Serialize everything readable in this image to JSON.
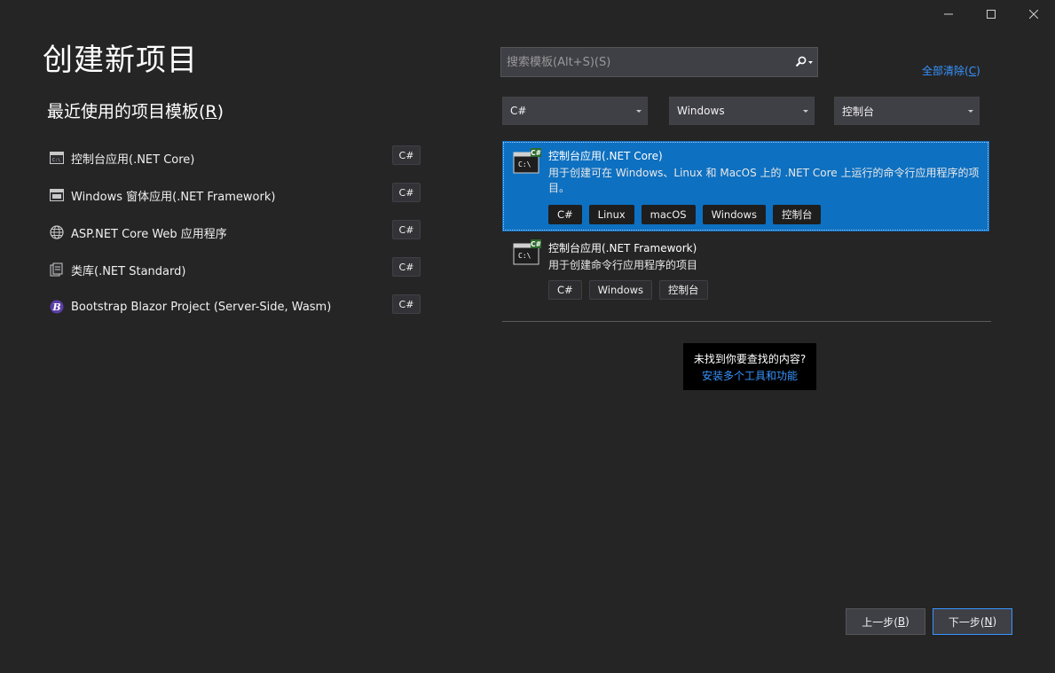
{
  "window": {
    "minimize_icon": "minimize-icon",
    "maximize_icon": "maximize-icon",
    "close_icon": "close-icon"
  },
  "page": {
    "title": "创建新项目"
  },
  "recent": {
    "heading_prefix": "最近使用的项目模板(",
    "heading_hotkey": "R",
    "heading_suffix": ")",
    "items": [
      {
        "label": "控制台应用(.NET Core)",
        "lang": "C#",
        "icon": "console-app-icon"
      },
      {
        "label": "Windows 窗体应用(.NET Framework)",
        "lang": "C#",
        "icon": "windows-forms-icon"
      },
      {
        "label": "ASP.NET Core Web 应用程序",
        "lang": "C#",
        "icon": "web-globe-icon"
      },
      {
        "label": "类库(.NET Standard)",
        "lang": "C#",
        "icon": "class-library-icon"
      },
      {
        "label": "Bootstrap Blazor Project (Server-Side, Wasm)",
        "lang": "C#",
        "icon": "bootstrap-blazor-icon"
      }
    ]
  },
  "search": {
    "placeholder": "搜索模板(Alt+S)(S)",
    "value": ""
  },
  "clear_all": {
    "prefix": "全部清除(",
    "hotkey": "C",
    "suffix": ")"
  },
  "filters": {
    "language": "C#",
    "platform": "Windows",
    "project_type": "控制台"
  },
  "templates": [
    {
      "title": "控制台应用(.NET Core)",
      "description": "用于创建可在 Windows、Linux 和 MacOS 上的 .NET Core 上运行的命令行应用程序的项目。",
      "tags": [
        "C#",
        "Linux",
        "macOS",
        "Windows",
        "控制台"
      ],
      "selected": true
    },
    {
      "title": "控制台应用(.NET Framework)",
      "description": "用于创建命令行应用程序的项目",
      "tags": [
        "C#",
        "Windows",
        "控制台"
      ],
      "selected": false
    }
  ],
  "not_found": {
    "text": "未找到你要查找的内容?",
    "link": "安装多个工具和功能"
  },
  "footer": {
    "back_prefix": "上一步(",
    "back_hotkey": "B",
    "back_suffix": ")",
    "next_prefix": "下一步(",
    "next_hotkey": "N",
    "next_suffix": ")"
  },
  "colors": {
    "background": "#252526",
    "selected": "#0e70c0",
    "link": "#3794ff"
  }
}
